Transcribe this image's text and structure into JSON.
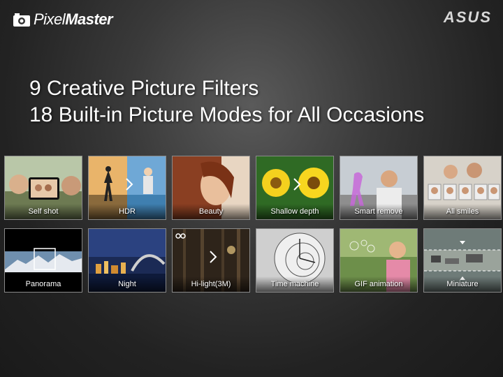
{
  "header": {
    "logo_light": "Pixel",
    "logo_bold": "Master",
    "brand": "ASUS"
  },
  "headline": [
    "9 Creative Picture Filters",
    "18 Built-in Picture Modes for All Occasions"
  ],
  "modes": [
    {
      "label": "Self shot",
      "icon": "selfie-icon"
    },
    {
      "label": "HDR",
      "icon": "hdr-icon"
    },
    {
      "label": "Beauty",
      "icon": "beauty-icon"
    },
    {
      "label": "Shallow depth",
      "icon": "flower-icon"
    },
    {
      "label": "Smart remove",
      "icon": "remove-icon"
    },
    {
      "label": "All smiles",
      "icon": "smiles-icon"
    },
    {
      "label": "Panorama",
      "icon": "panorama-icon"
    },
    {
      "label": "Night",
      "icon": "night-icon"
    },
    {
      "label": "Hi-light(3M)",
      "icon": "owl-icon"
    },
    {
      "label": "Time machine",
      "icon": "clock-icon"
    },
    {
      "label": "GIF animation",
      "icon": "gif-icon"
    },
    {
      "label": "Miniature",
      "icon": "miniature-icon"
    }
  ]
}
